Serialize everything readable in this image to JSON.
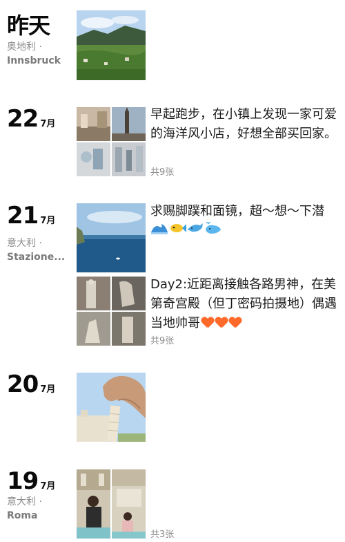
{
  "entries": [
    {
      "day": "昨天",
      "month": "",
      "location_line1": "奥地利 ·",
      "location_line2": "Innsbruck"
    },
    {
      "day": "22",
      "month": "7月",
      "caption": "早起跑步，在小镇上发现一家可爱的海洋风小店，好想全部买回家。",
      "count": "共9张"
    },
    {
      "day": "21",
      "month": "7月",
      "location_line1": "意大利 ·",
      "location_line2": "Stazione...",
      "posts": [
        {
          "caption": "求赐脚蹼和面镜，超～想～下潜",
          "emojis": [
            "wave-emoji",
            "fish-emoji",
            "dolphin-emoji",
            "whale-emoji"
          ]
        },
        {
          "caption": "Day2:近距离接触各路男神，在美第奇宫殿（但丁密码拍摄地）偶遇当地帅哥",
          "emojis": [
            "heart-emoji",
            "heart-emoji",
            "heart-emoji"
          ],
          "count": "共9张"
        }
      ]
    },
    {
      "day": "20",
      "month": "7月"
    },
    {
      "day": "19",
      "month": "7月",
      "location_line1": "意大利 ·",
      "location_line2": "Roma",
      "count": "共3张"
    }
  ],
  "colors": {
    "text": "#1a1a1a",
    "secondary": "#8a8a8a",
    "heart": "#ff6a2b"
  }
}
